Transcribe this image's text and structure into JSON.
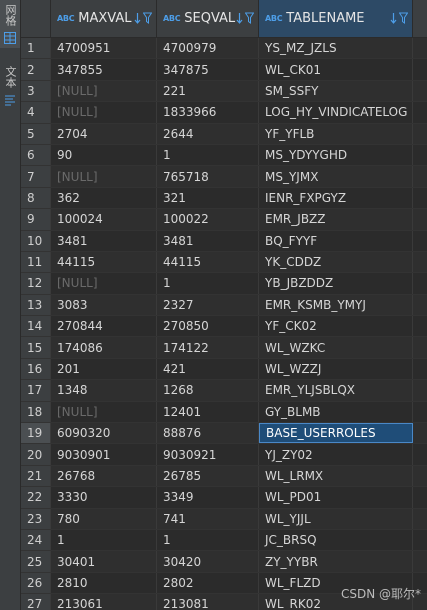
{
  "sidebar": {
    "tab1": "网格",
    "tab2": "文本"
  },
  "columns": [
    "MAXVAL",
    "SEQVAL",
    "TABLENAME"
  ],
  "type_badge": "ABC",
  "rows": [
    [
      "1",
      "4700951",
      "4700979",
      "YS_MZ_JZLS"
    ],
    [
      "2",
      "347855",
      "347875",
      "WL_CK01"
    ],
    [
      "3",
      "[NULL]",
      "221",
      "SM_SSFY"
    ],
    [
      "4",
      "[NULL]",
      "1833966",
      "LOG_HY_VINDICATELOG"
    ],
    [
      "5",
      "2704",
      "2644",
      "YF_YFLB"
    ],
    [
      "6",
      "90",
      "1",
      "MS_YDYYGHD"
    ],
    [
      "7",
      "[NULL]",
      "765718",
      "MS_YJMX"
    ],
    [
      "8",
      "362",
      "321",
      "IENR_FXPGYZ"
    ],
    [
      "9",
      "100024",
      "100022",
      "EMR_JBZZ"
    ],
    [
      "10",
      "3481",
      "3481",
      "BQ_FYYF"
    ],
    [
      "11",
      "44115",
      "44115",
      "YK_CDDZ"
    ],
    [
      "12",
      "[NULL]",
      "1",
      "YB_JBZDDZ"
    ],
    [
      "13",
      "3083",
      "2327",
      "EMR_KSMB_YMYJ"
    ],
    [
      "14",
      "270844",
      "270850",
      "YF_CK02"
    ],
    [
      "15",
      "174086",
      "174122",
      "WL_WZKC"
    ],
    [
      "16",
      "201",
      "421",
      "WL_WZZJ"
    ],
    [
      "17",
      "1348",
      "1268",
      "EMR_YLJSBLQX"
    ],
    [
      "18",
      "[NULL]",
      "12401",
      "GY_BLMB"
    ],
    [
      "19",
      "6090320",
      "88876",
      "BASE_USERROLES"
    ],
    [
      "20",
      "9030901",
      "9030921",
      "YJ_ZY02"
    ],
    [
      "21",
      "26768",
      "26785",
      "WL_LRMX"
    ],
    [
      "22",
      "3330",
      "3349",
      "WL_PD01"
    ],
    [
      "23",
      "780",
      "741",
      "WL_YJJL"
    ],
    [
      "24",
      "1",
      "1",
      "JC_BRSQ"
    ],
    [
      "25",
      "30401",
      "30420",
      "ZY_YYBR"
    ],
    [
      "26",
      "2810",
      "2802",
      "WL_FLZD"
    ],
    [
      "27",
      "213061",
      "213081",
      "WL_RK02"
    ]
  ],
  "selected_row": 19,
  "watermark": "CSDN @耶尔*"
}
